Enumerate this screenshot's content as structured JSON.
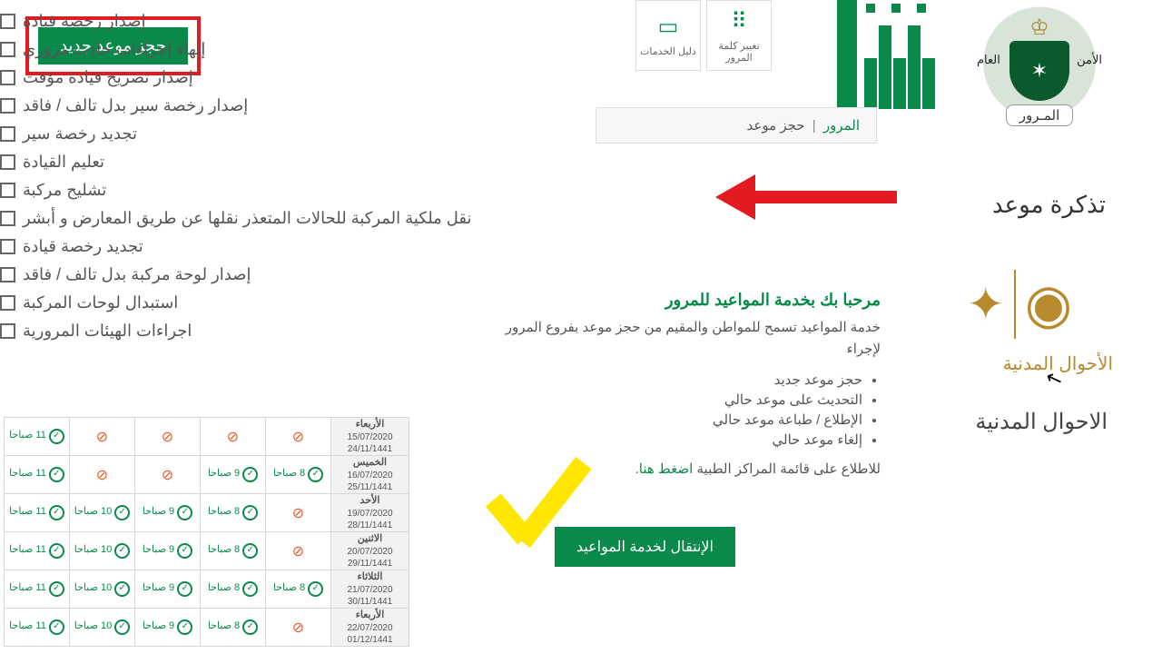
{
  "newBookingBtn": "حجز موعد جديد",
  "services": [
    "إصدار رخصة قيادة",
    "إنهاء إجراءات حادث مروري",
    "إصدار تصريح قيادة مؤقت",
    "إصدار رخصة سير بدل تالف / فاقد",
    "تجديد رخصة سير",
    "تعليم القيادة",
    "تشليح مركبة",
    "نقل ملكية المركبة للحالات المتعذر نقلها عن طريق المعارض و أبشر",
    "تجديد رخصة قيادة",
    "إصدار لوحة مركبة بدل تالف / فاقد",
    "استبدال لوحات المركبة",
    "اجراءات الهيئات المرورية"
  ],
  "toolbar": {
    "changePass": "تغيير كلمة المرور",
    "guide": "دليل الخدمات"
  },
  "breadcrumb": {
    "root": "المرور",
    "current": "حجز موعد"
  },
  "emblem": {
    "right": "الأمن",
    "left": "العام",
    "banner": "المـرور"
  },
  "ticketLabel": "تذكرة موعد",
  "civilLogoText": "الأحوال المدنية",
  "civilText": "الاحوال المدنية",
  "welcome": {
    "title": "مرحبا بك بخدمة المواعيد للمرور",
    "desc": "خدمة المواعيد تسمح للمواطن والمقيم من حجز موعد بفروع المرور لإجراء",
    "items": [
      "حجز موعد جديد",
      "التحديث على موعد حالي",
      "الإطلاع / طباعة موعد حالي",
      "إلغاء موعد حالي"
    ],
    "note": "للاطلاع على قائمة المراكز الطبية",
    "link": "اضغط هنا."
  },
  "goBtn": "الإنتقال لخدمة المواعيد",
  "schedule": {
    "days": [
      {
        "name": "الأربعاء",
        "g": "15/07/2020",
        "h": "24/11/1441",
        "slots": [
          "⊘",
          "⊘",
          "⊘",
          "⊘",
          "11 صباحا"
        ]
      },
      {
        "name": "الخميس",
        "g": "16/07/2020",
        "h": "25/11/1441",
        "slots": [
          "8 صباحا",
          "9 صباحا",
          "⊘",
          "⊘",
          "11 صباحا"
        ]
      },
      {
        "name": "الأحد",
        "g": "19/07/2020",
        "h": "28/11/1441",
        "slots": [
          "⊘",
          "8 صباحا",
          "9 صباحا",
          "10 صباحا",
          "11 صباحا"
        ]
      },
      {
        "name": "الاثنين",
        "g": "20/07/2020",
        "h": "29/11/1441",
        "slots": [
          "⊘",
          "8 صباحا",
          "9 صباحا",
          "10 صباحا",
          "11 صباحا"
        ]
      },
      {
        "name": "الثلاثاء",
        "g": "21/07/2020",
        "h": "30/11/1441",
        "slots": [
          "8 صباحا",
          "8 صباحا",
          "9 صباحا",
          "10 صباحا",
          "11 صباحا"
        ]
      },
      {
        "name": "الأربعاء",
        "g": "22/07/2020",
        "h": "01/12/1441",
        "slots": [
          "⊘",
          "8 صباحا",
          "9 صباحا",
          "10 صباحا",
          "11 صباحا"
        ]
      }
    ]
  }
}
